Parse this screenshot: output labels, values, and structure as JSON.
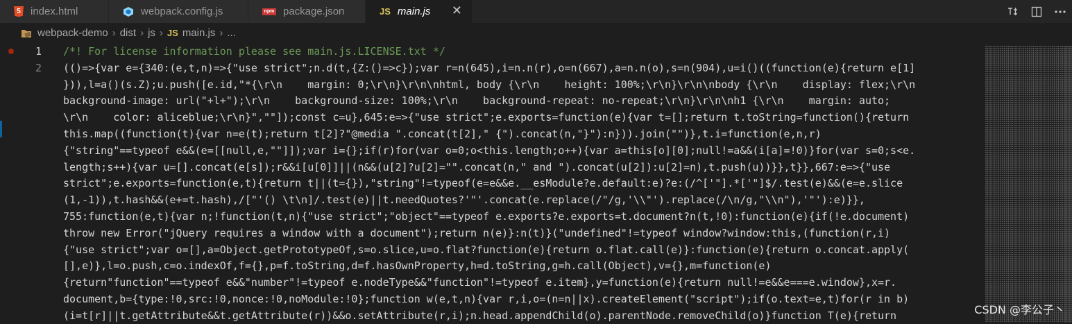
{
  "tabs": [
    {
      "label": "index.html",
      "icon": "html5-icon"
    },
    {
      "label": "webpack.config.js",
      "icon": "webpack-cube-icon"
    },
    {
      "label": "package.json",
      "icon": "npm-icon"
    },
    {
      "label": "main.js",
      "icon": "js-icon",
      "active": true
    }
  ],
  "tab_icon_text": {
    "html": "5",
    "npm": "npm",
    "js": "JS"
  },
  "close_glyph": "✕",
  "breadcrumb": {
    "project": "webpack-demo",
    "dir1": "dist",
    "dir2": "js",
    "file": "main.js",
    "more": "...",
    "sep": "›"
  },
  "editor": {
    "line_numbers": [
      "1",
      "2"
    ],
    "lines": [
      "/*! For license information please see main.js.LICENSE.txt */",
      "(()=>{var e={340:(e,t,n)=>{\"use strict\";n.d(t,{Z:()=>c});var r=n(645),i=n.n(r),o=n(667),a=n.n(o),s=n(904),u=i()((function(e){return e[1]",
      "})),l=a()(s.Z);u.push([e.id,\"*{\\r\\n    margin: 0;\\r\\n}\\r\\n\\nhtml, body {\\r\\n    height: 100%;\\r\\n}\\r\\n\\nbody {\\r\\n    display: flex;\\r\\n",
      "background-image: url(\"+l+\");\\r\\n    background-size: 100%;\\r\\n    background-repeat: no-repeat;\\r\\n}\\r\\n\\nh1 {\\r\\n    margin: auto;",
      "\\r\\n    color: aliceblue;\\r\\n}\",\"\"]);const c=u},645:e=>{\"use strict\";e.exports=function(e){var t=[];return t.toString=function(){return",
      "this.map((function(t){var n=e(t);return t[2]?\"@media \".concat(t[2],\" {\").concat(n,\"}\"):n})).join(\"\")},t.i=function(e,n,r)",
      "{\"string\"==typeof e&&(e=[[null,e,\"\"]]);var i={};if(r)for(var o=0;o<this.length;o++){var a=this[o][0];null!=a&&(i[a]=!0)}for(var s=0;s<e.",
      "length;s++){var u=[].concat(e[s]);r&&i[u[0]]||(n&&(u[2]?u[2]=\"\".concat(n,\" and \").concat(u[2]):u[2]=n),t.push(u))}},t}},667:e=>{\"use",
      "strict\";e.exports=function(e,t){return t||(t={}),\"string\"!=typeof(e=e&&e.__esModule?e.default:e)?e:(/^['\"].*['\"]$/.test(e)&&(e=e.slice",
      "(1,-1)),t.hash&&(e+=t.hash),/[\"'() \\t\\n]/.test(e)||t.needQuotes?'\"'.concat(e.replace(/\"/g,'\\\\\"').replace(/\\n/g,\"\\\\n\"),'\"'):e)}},",
      "755:function(e,t){var n;!function(t,n){\"use strict\";\"object\"==typeof e.exports?e.exports=t.document?n(t,!0):function(e){if(!e.document)",
      "throw new Error(\"jQuery requires a window with a document\");return n(e)}:n(t)}(\"undefined\"!=typeof window?window:this,(function(r,i)",
      "{\"use strict\";var o=[],a=Object.getPrototypeOf,s=o.slice,u=o.flat?function(e){return o.flat.call(e)}:function(e){return o.concat.apply(",
      "[],e)},l=o.push,c=o.indexOf,f={},p=f.toString,d=f.hasOwnProperty,h=d.toString,g=h.call(Object),v={},m=function(e)",
      "{return\"function\"==typeof e&&\"number\"!=typeof e.nodeType&&\"function\"!=typeof e.item},y=function(e){return null!=e&&e===e.window},x=r.",
      "document,b={type:!0,src:!0,nonce:!0,noModule:!0};function w(e,t,n){var r,i,o=(n=n||x).createElement(\"script\");if(o.text=e,t)for(r in b)",
      "(i=t[r]||t.getAttribute&&t.getAttribute(r))&&o.setAttribute(r,i);n.head.appendChild(o).parentNode.removeChild(o)}function T(e){return"
    ]
  },
  "watermark": "CSDN @李公子丶"
}
